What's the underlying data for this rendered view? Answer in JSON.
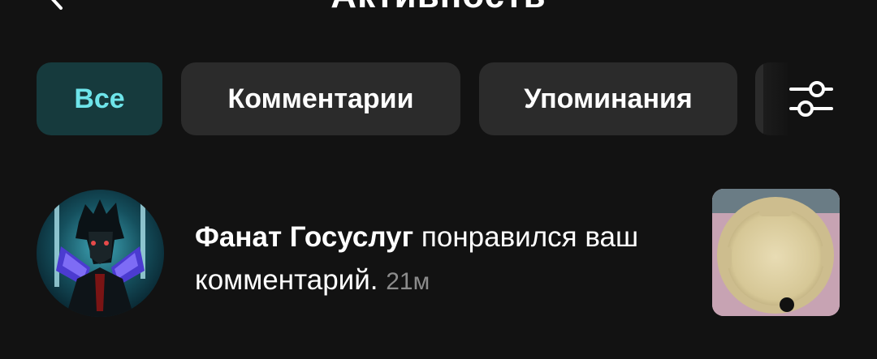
{
  "header": {
    "title": "Активность",
    "back_icon": "chevron-left-icon"
  },
  "tabs": [
    {
      "label": "Все",
      "active": true
    },
    {
      "label": "Комментарии",
      "active": false
    },
    {
      "label": "Упоминания",
      "active": false
    }
  ],
  "filter": {
    "icon": "sliders-icon"
  },
  "notification": {
    "user": "Фанат Госуслуг",
    "action": "понравился ваш комментарий.",
    "time": "21м",
    "avatar_icon": "anime-character-avatar",
    "thumbnail_icon": "video-thumbnail"
  },
  "colors": {
    "background": "#121212",
    "tab_bg": "#2b2b2b",
    "active_tab_bg": "#163a3d",
    "active_tab_text": "#6ee4ea",
    "time_text": "#8c8c8c"
  }
}
